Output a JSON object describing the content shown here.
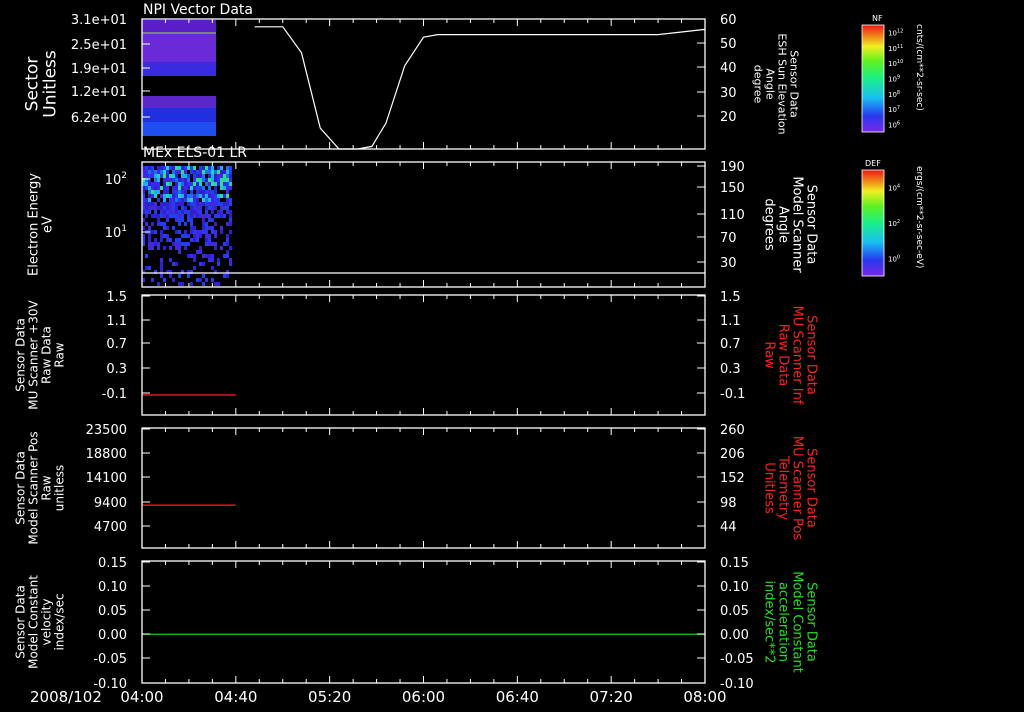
{
  "colors": {
    "background": "#000000",
    "axis": "#ffffff",
    "red": "#ff2020",
    "green": "#20e020"
  },
  "time_axis": {
    "date_label": "2008/102",
    "ticks": [
      "04:00",
      "04:40",
      "05:20",
      "06:00",
      "06:40",
      "07:20",
      "08:00"
    ]
  },
  "panels": [
    {
      "id": "npi",
      "title": "NPI Vector Data",
      "left_label": [
        "Sector",
        "Unitless"
      ],
      "left_ticks": [
        "3.1e+01",
        "2.5e+01",
        "1.9e+01",
        "1.2e+01",
        "6.2e+00"
      ],
      "right_label": [
        "Sensor Data",
        "ESH Sun Elevation",
        "Angle",
        "degree"
      ],
      "right_ticks": [
        "60",
        "50",
        "40",
        "30",
        "20"
      ]
    },
    {
      "id": "els",
      "title": "MEx ELS-01 LR",
      "left_label": [
        "Electron Energy",
        "eV"
      ],
      "left_ticks": [
        "10",
        "10"
      ],
      "left_tick_exponents": [
        "2",
        "1"
      ],
      "right_label": [
        "Sensor Data",
        "Model Scanner",
        "Angle",
        "degrees"
      ],
      "right_ticks": [
        "190",
        "150",
        "110",
        "70",
        "30"
      ]
    },
    {
      "id": "mu_raw",
      "left_label": [
        "Sensor Data",
        "MU Scanner +30V",
        "Raw Data",
        "Raw"
      ],
      "left_ticks": [
        "1.5",
        "1.1",
        "0.7",
        "0.3",
        "-0.1"
      ],
      "right_label": [
        "Sensor Data",
        "MU Scanner Inf",
        "Raw Data",
        "Raw"
      ],
      "right_ticks": [
        "1.5",
        "1.1",
        "0.7",
        "0.3",
        "-0.1"
      ]
    },
    {
      "id": "scanner_pos",
      "left_label": [
        "Sensor Data",
        "Model Scanner Pos",
        "Raw",
        "unitless"
      ],
      "left_ticks": [
        "23500",
        "18800",
        "14100",
        "9400",
        "4700"
      ],
      "right_label": [
        "Sensor Data",
        "MU Scanner Pos",
        "Telemetry",
        "Unitless"
      ],
      "right_ticks": [
        "260",
        "206",
        "152",
        "98",
        "44"
      ]
    },
    {
      "id": "constant",
      "left_label": [
        "Sensor Data",
        "Model Constant",
        "velocity",
        "index/sec"
      ],
      "left_ticks": [
        "0.15",
        "0.10",
        "0.05",
        "0.00",
        "-0.05",
        "-0.10"
      ],
      "right_label": [
        "Sensor Data",
        "Model Constant",
        "acceleration",
        "index/sec**2"
      ],
      "right_ticks": [
        "0.15",
        "0.10",
        "0.05",
        "0.00",
        "-0.05",
        "-0.10"
      ]
    }
  ],
  "colorbars": [
    {
      "title": "NF",
      "label": "cnts/(cm**2-sr-sec)",
      "ticks": [
        "10",
        "10",
        "10",
        "10",
        "10",
        "10",
        "10"
      ],
      "tick_exponents": [
        "12",
        "11",
        "10",
        "9",
        "8",
        "7",
        "6"
      ]
    },
    {
      "title": "DEF",
      "label": "ergs/(cm**2-sr-sec-eV)",
      "ticks": [
        "10",
        "10",
        "10"
      ],
      "tick_exponents": [
        "4",
        "2",
        "0"
      ]
    }
  ],
  "chart_data": [
    {
      "type": "line",
      "title": "NPI Vector Data",
      "series": [
        {
          "name": "Sensor Data ESH Sun Elevation Angle",
          "x": [
            "04:00",
            "04:24",
            "04:48",
            "05:00",
            "05:08",
            "05:16",
            "05:24",
            "05:32",
            "05:38",
            "05:44",
            "05:52",
            "06:00",
            "06:06",
            "06:16",
            "06:40",
            "07:20",
            "07:40",
            "08:00"
          ],
          "values": [
            51,
            53,
            57,
            57,
            47,
            18,
            10,
            10,
            11,
            20,
            42,
            53,
            54,
            54,
            54,
            54,
            54,
            56
          ]
        }
      ],
      "ylim": [
        10,
        60
      ],
      "spectrogram": {
        "axis": "Sector",
        "ylim": [
          0,
          31
        ],
        "x_range": [
          "04:00",
          "04:37"
        ]
      }
    },
    {
      "type": "heatmap",
      "title": "MEx ELS-01 LR",
      "spectrogram": {
        "axis": "Electron Energy",
        "x_range": [
          "04:00",
          "04:38"
        ]
      },
      "series": [
        {
          "name": "Sensor Data Model Scanner Angle",
          "x": [
            "04:00",
            "08:00"
          ],
          "values": [
            23,
            23
          ]
        }
      ],
      "ylim": [
        10,
        190
      ]
    },
    {
      "type": "line",
      "series": [
        {
          "name": "Sensor Data MU Scanner +30V Raw Data",
          "x": [
            "04:00",
            "04:40"
          ],
          "values": [
            0.0,
            0.0
          ]
        }
      ],
      "ylim": [
        -0.3,
        1.5
      ]
    },
    {
      "type": "line",
      "series": [
        {
          "name": "Sensor Data Model Scanner Pos",
          "x": [
            "04:00",
            "04:40"
          ],
          "values": [
            8400,
            8400
          ]
        }
      ],
      "ylim": [
        0,
        23500
      ]
    },
    {
      "type": "line",
      "series": [
        {
          "name": "Sensor Data Model Constant velocity",
          "x": [
            "04:00",
            "08:00"
          ],
          "values": [
            0.0,
            0.0
          ]
        }
      ],
      "ylim": [
        -0.1,
        0.15
      ]
    }
  ]
}
